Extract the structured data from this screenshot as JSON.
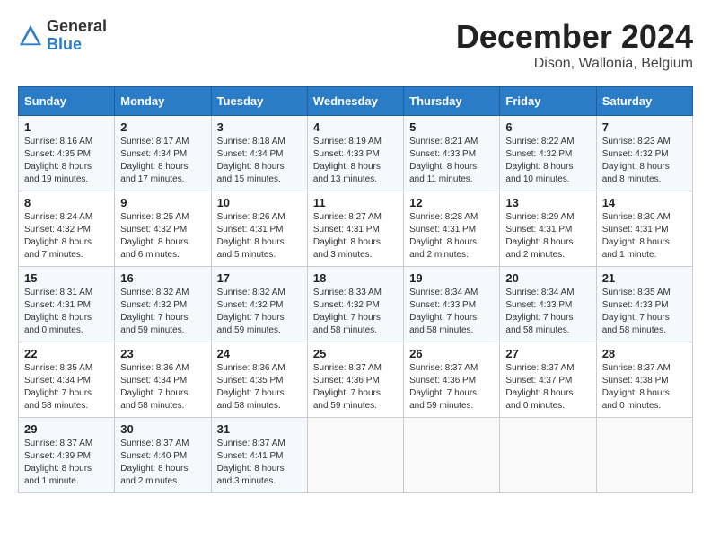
{
  "header": {
    "logo_general": "General",
    "logo_blue": "Blue",
    "month_title": "December 2024",
    "location": "Dison, Wallonia, Belgium"
  },
  "days_of_week": [
    "Sunday",
    "Monday",
    "Tuesday",
    "Wednesday",
    "Thursday",
    "Friday",
    "Saturday"
  ],
  "weeks": [
    [
      {
        "day": "1",
        "sunrise": "8:16 AM",
        "sunset": "4:35 PM",
        "daylight": "8 hours and 19 minutes."
      },
      {
        "day": "2",
        "sunrise": "8:17 AM",
        "sunset": "4:34 PM",
        "daylight": "8 hours and 17 minutes."
      },
      {
        "day": "3",
        "sunrise": "8:18 AM",
        "sunset": "4:34 PM",
        "daylight": "8 hours and 15 minutes."
      },
      {
        "day": "4",
        "sunrise": "8:19 AM",
        "sunset": "4:33 PM",
        "daylight": "8 hours and 13 minutes."
      },
      {
        "day": "5",
        "sunrise": "8:21 AM",
        "sunset": "4:33 PM",
        "daylight": "8 hours and 11 minutes."
      },
      {
        "day": "6",
        "sunrise": "8:22 AM",
        "sunset": "4:32 PM",
        "daylight": "8 hours and 10 minutes."
      },
      {
        "day": "7",
        "sunrise": "8:23 AM",
        "sunset": "4:32 PM",
        "daylight": "8 hours and 8 minutes."
      }
    ],
    [
      {
        "day": "8",
        "sunrise": "8:24 AM",
        "sunset": "4:32 PM",
        "daylight": "8 hours and 7 minutes."
      },
      {
        "day": "9",
        "sunrise": "8:25 AM",
        "sunset": "4:32 PM",
        "daylight": "8 hours and 6 minutes."
      },
      {
        "day": "10",
        "sunrise": "8:26 AM",
        "sunset": "4:31 PM",
        "daylight": "8 hours and 5 minutes."
      },
      {
        "day": "11",
        "sunrise": "8:27 AM",
        "sunset": "4:31 PM",
        "daylight": "8 hours and 3 minutes."
      },
      {
        "day": "12",
        "sunrise": "8:28 AM",
        "sunset": "4:31 PM",
        "daylight": "8 hours and 2 minutes."
      },
      {
        "day": "13",
        "sunrise": "8:29 AM",
        "sunset": "4:31 PM",
        "daylight": "8 hours and 2 minutes."
      },
      {
        "day": "14",
        "sunrise": "8:30 AM",
        "sunset": "4:31 PM",
        "daylight": "8 hours and 1 minute."
      }
    ],
    [
      {
        "day": "15",
        "sunrise": "8:31 AM",
        "sunset": "4:31 PM",
        "daylight": "8 hours and 0 minutes."
      },
      {
        "day": "16",
        "sunrise": "8:32 AM",
        "sunset": "4:32 PM",
        "daylight": "7 hours and 59 minutes."
      },
      {
        "day": "17",
        "sunrise": "8:32 AM",
        "sunset": "4:32 PM",
        "daylight": "7 hours and 59 minutes."
      },
      {
        "day": "18",
        "sunrise": "8:33 AM",
        "sunset": "4:32 PM",
        "daylight": "7 hours and 58 minutes."
      },
      {
        "day": "19",
        "sunrise": "8:34 AM",
        "sunset": "4:33 PM",
        "daylight": "7 hours and 58 minutes."
      },
      {
        "day": "20",
        "sunrise": "8:34 AM",
        "sunset": "4:33 PM",
        "daylight": "7 hours and 58 minutes."
      },
      {
        "day": "21",
        "sunrise": "8:35 AM",
        "sunset": "4:33 PM",
        "daylight": "7 hours and 58 minutes."
      }
    ],
    [
      {
        "day": "22",
        "sunrise": "8:35 AM",
        "sunset": "4:34 PM",
        "daylight": "7 hours and 58 minutes."
      },
      {
        "day": "23",
        "sunrise": "8:36 AM",
        "sunset": "4:34 PM",
        "daylight": "7 hours and 58 minutes."
      },
      {
        "day": "24",
        "sunrise": "8:36 AM",
        "sunset": "4:35 PM",
        "daylight": "7 hours and 58 minutes."
      },
      {
        "day": "25",
        "sunrise": "8:37 AM",
        "sunset": "4:36 PM",
        "daylight": "7 hours and 59 minutes."
      },
      {
        "day": "26",
        "sunrise": "8:37 AM",
        "sunset": "4:36 PM",
        "daylight": "7 hours and 59 minutes."
      },
      {
        "day": "27",
        "sunrise": "8:37 AM",
        "sunset": "4:37 PM",
        "daylight": "8 hours and 0 minutes."
      },
      {
        "day": "28",
        "sunrise": "8:37 AM",
        "sunset": "4:38 PM",
        "daylight": "8 hours and 0 minutes."
      }
    ],
    [
      {
        "day": "29",
        "sunrise": "8:37 AM",
        "sunset": "4:39 PM",
        "daylight": "8 hours and 1 minute."
      },
      {
        "day": "30",
        "sunrise": "8:37 AM",
        "sunset": "4:40 PM",
        "daylight": "8 hours and 2 minutes."
      },
      {
        "day": "31",
        "sunrise": "8:37 AM",
        "sunset": "4:41 PM",
        "daylight": "8 hours and 3 minutes."
      },
      null,
      null,
      null,
      null
    ]
  ]
}
